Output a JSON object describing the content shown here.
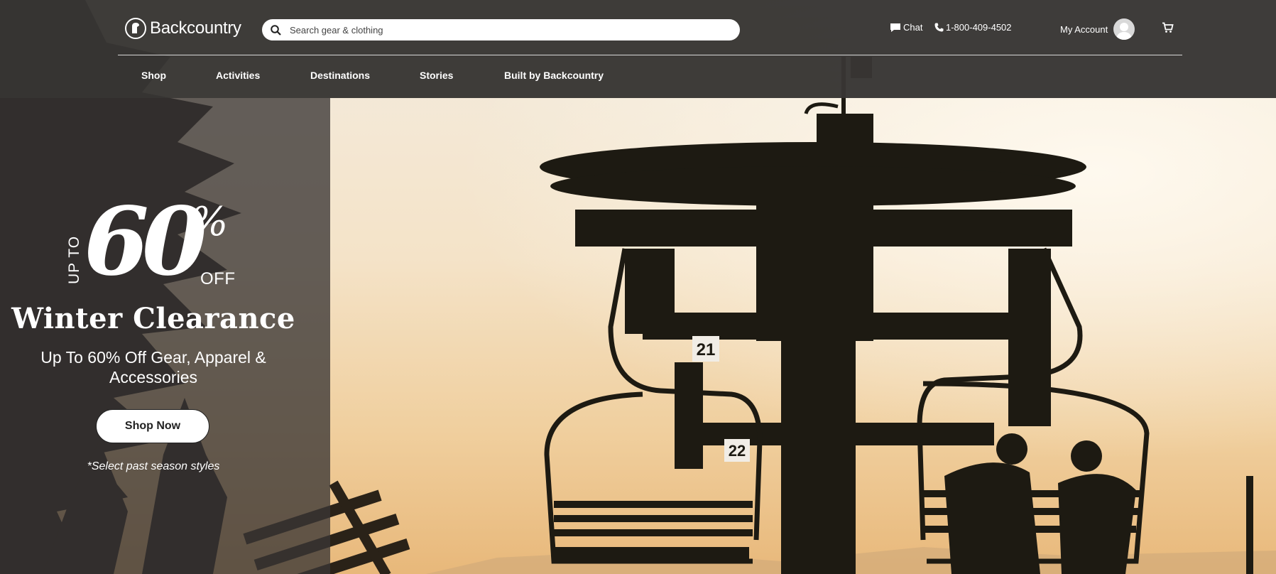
{
  "header": {
    "logo_text": "Backcountry",
    "search_placeholder": "Search gear & clothing",
    "chat_label": "Chat",
    "phone_label": "1-800-409-4502",
    "account_label": "My Account"
  },
  "nav": {
    "items": [
      {
        "label": "Shop"
      },
      {
        "label": "Activities"
      },
      {
        "label": "Destinations"
      },
      {
        "label": "Stories"
      },
      {
        "label": "Built by Backcountry"
      }
    ]
  },
  "promo": {
    "up_to": "UP TO",
    "number": "60",
    "percent": "%",
    "off": "OFF",
    "headline": "Winter Clearance",
    "subhead": "Up To 60% Off Gear, Apparel & Accessories",
    "cta_label": "Shop Now",
    "disclaimer": "*Select past season styles"
  },
  "hero": {
    "chair_numbers": [
      "21",
      "22"
    ]
  },
  "colors": {
    "header_bg": "#383634",
    "promo_panel": "#3a3634",
    "sky_light": "#f3ece0",
    "sky_warm": "#e8b87a",
    "silhouette": "#1d1a12"
  },
  "icons": [
    "search-icon",
    "chat-icon",
    "phone-icon",
    "avatar-icon",
    "cart-icon",
    "logo-icon"
  ]
}
